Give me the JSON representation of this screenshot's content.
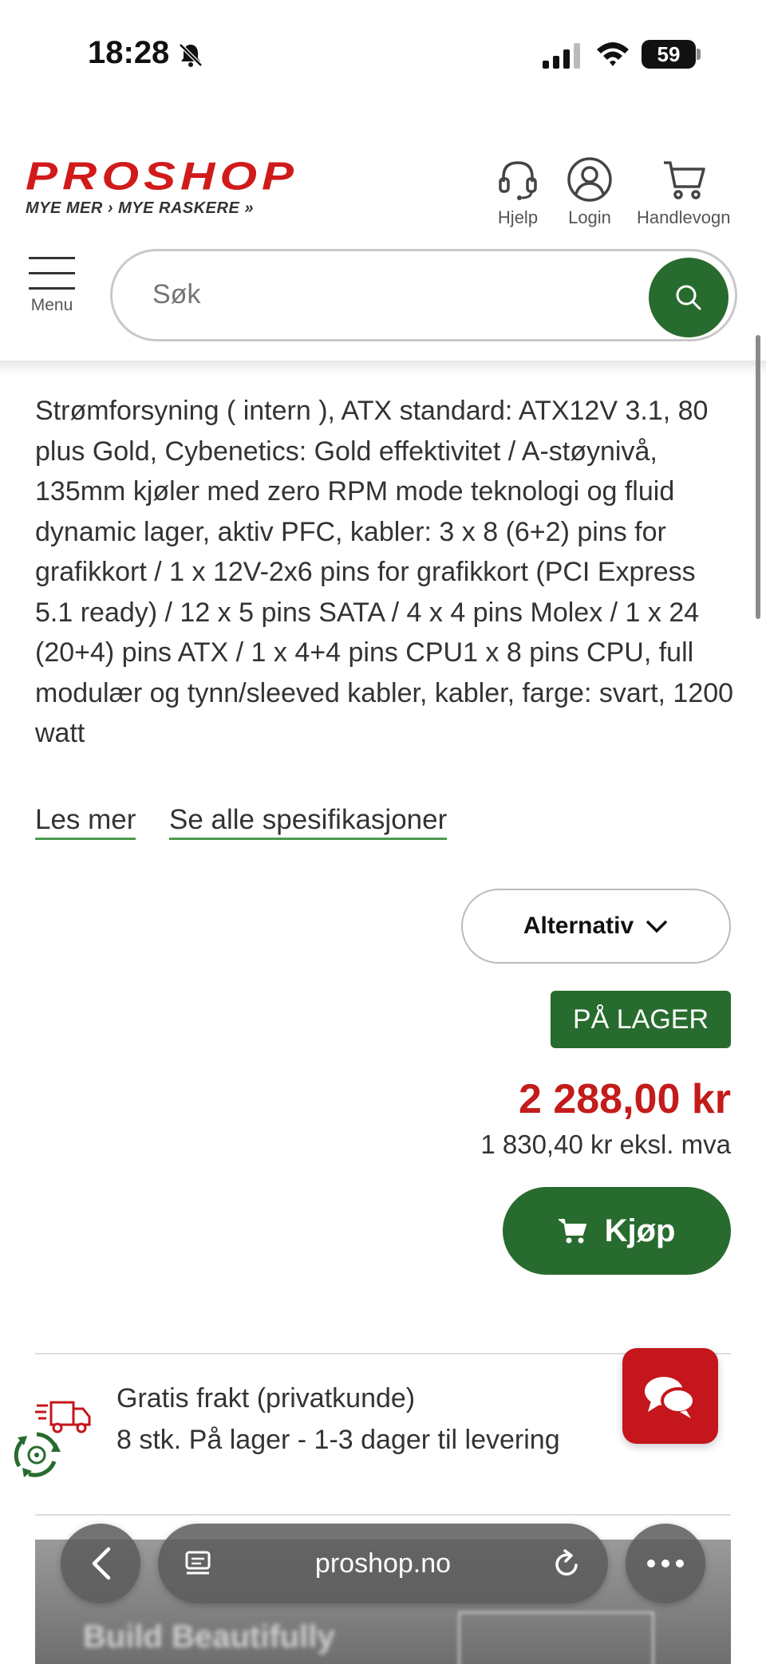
{
  "status_bar": {
    "time": "18:28",
    "battery": "59"
  },
  "header": {
    "logo_text": "PROSHOP",
    "logo_tagline": "MYE MER › MYE RASKERE »",
    "help_label": "Hjelp",
    "login_label": "Login",
    "cart_label": "Handlevogn",
    "menu_label": "Menu",
    "search_placeholder": "Søk"
  },
  "product": {
    "description": "Strømforsyning ( intern ), ATX standard: ATX12V 3.1, 80 plus Gold, Cybenetics: Gold effektivitet / A-støynivå, 135mm kjøler med zero RPM mode teknologi og fluid dynamic lager, aktiv PFC, kabler: 3 x 8 (6+2) pins for grafikkort / 1 x 12V-2x6 pins for grafikkort (PCI Express 5.1 ready) / 12 x 5 pins SATA / 4 x 4 pins Molex / 1 x 24 (20+4) pins ATX / 1 x 4+4 pins CPU1 x 8 pins CPU, full modulær og tynn/sleeved kabler, kabler, farge: svart, 1200 watt",
    "read_more": "Les mer",
    "all_specs": "Se alle spesifikasjoner",
    "alternative_label": "Alternativ",
    "stock_badge": "PÅ LAGER",
    "price": "2 288,00 kr",
    "price_ex_vat": "1 830,40 kr eksl. mva",
    "buy_label": "Kjøp"
  },
  "shipping": {
    "line1": "Gratis frakt (privatkunde)",
    "line2": "8 stk. På lager - 1-3 dager til levering"
  },
  "banner": {
    "text": "Build Beautifully"
  },
  "browser": {
    "url": "proshop.no"
  },
  "colors": {
    "brand_green": "#286b2e",
    "brand_red": "#c4161c",
    "price_red": "#c41b1b"
  }
}
